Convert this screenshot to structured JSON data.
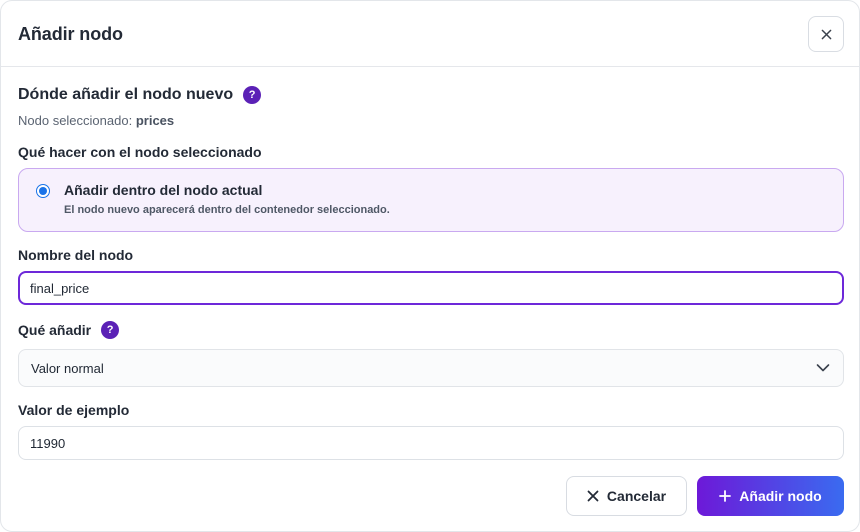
{
  "dialog": {
    "title": "Añadir nodo",
    "close_icon": "close-icon"
  },
  "location": {
    "section_title": "Dónde añadir el nodo nuevo",
    "help_glyph": "?",
    "selected_prefix": "Nodo seleccionado:",
    "selected_node": "prices"
  },
  "action": {
    "label": "Qué hacer con el nodo seleccionado",
    "options": [
      {
        "title": "Añadir dentro del nodo actual",
        "description": "El nodo nuevo aparecerá dentro del contenedor seleccionado.",
        "selected": true
      }
    ]
  },
  "node_name": {
    "label": "Nombre del nodo",
    "value": "final_price"
  },
  "what_to_add": {
    "label": "Qué añadir",
    "help_glyph": "?",
    "selected": "Valor normal"
  },
  "example_value": {
    "label": "Valor de ejemplo",
    "value": "11990"
  },
  "footer": {
    "cancel_label": "Cancelar",
    "add_label": "Añadir nodo"
  },
  "colors": {
    "accent": "#6d28d9",
    "help_icon": "#5b21b6",
    "radio": "#1a73e8",
    "option_bg": "#f7f1fd",
    "primary_gradient_start": "#6d19d8",
    "primary_gradient_end": "#3a6bf0"
  }
}
